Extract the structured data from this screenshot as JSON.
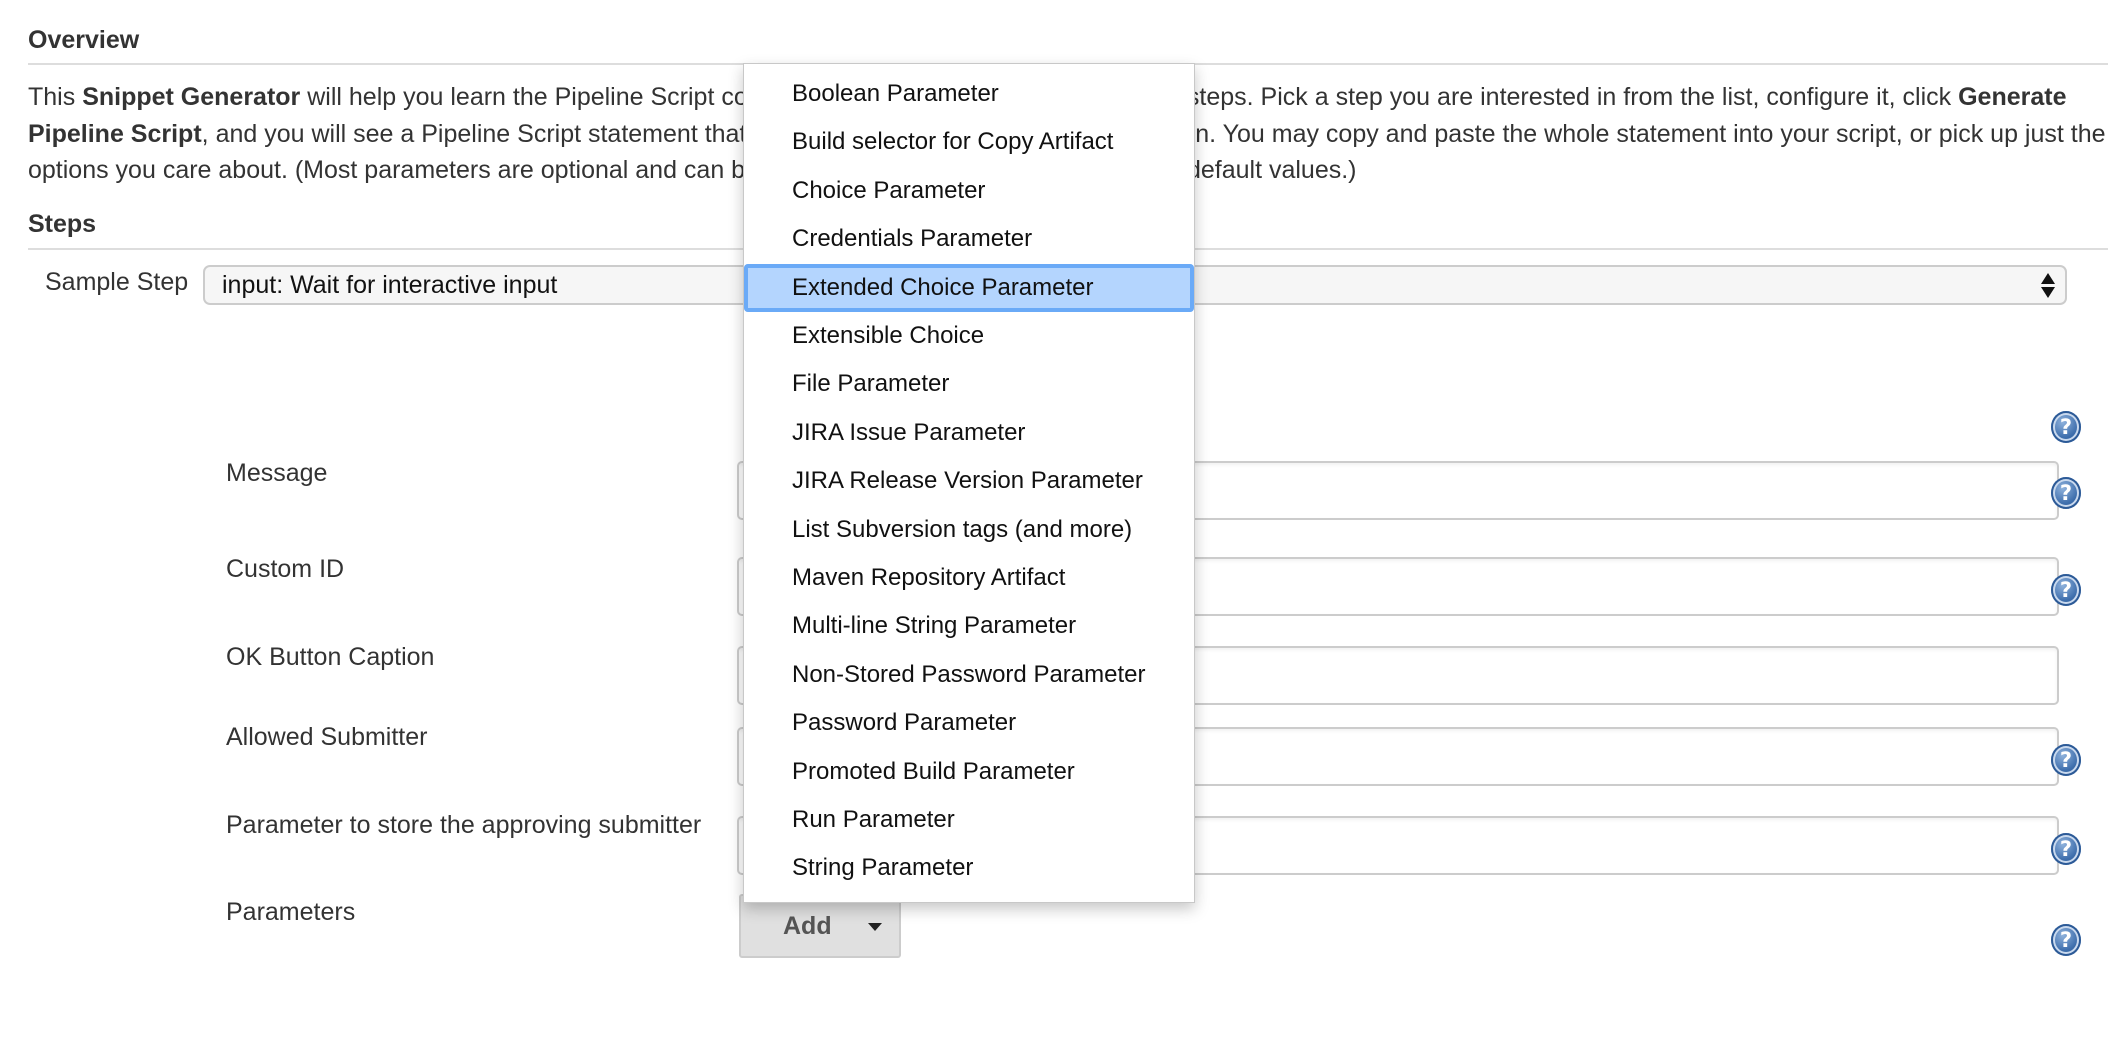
{
  "overview": {
    "title": "Overview",
    "text_parts": [
      {
        "text": "This ",
        "bold": false
      },
      {
        "text": "Snippet Generator",
        "bold": true
      },
      {
        "text": " will help you learn the Pipeline Script code which can be used to define various steps. Pick a step you are interested in from the list, configure it, click ",
        "bold": false
      },
      {
        "text": "Generate Pipeline Script",
        "bold": true
      },
      {
        "text": ", and you will see a Pipeline Script statement that would call the step with that configuration. You may copy and paste the whole statement into your script, or pick up just the options you care about. (Most parameters are optional and can be omitted in your script, leaving them at default values.)",
        "bold": false
      }
    ]
  },
  "steps": {
    "title": "Steps",
    "sample_step_label": "Sample Step",
    "sample_step_value": "input: Wait for interactive input"
  },
  "form": {
    "fields": [
      {
        "label": "Message",
        "value": "",
        "has_help": true
      },
      {
        "label": "Custom ID",
        "value": "",
        "has_help": true
      },
      {
        "label": "OK Button Caption",
        "value": "",
        "has_help": false
      },
      {
        "label": "Allowed Submitter",
        "value": "",
        "has_help": true
      },
      {
        "label": "Parameter to store the approving submitter",
        "value": "",
        "has_help": true
      }
    ],
    "parameters_label": "Parameters",
    "add_button_label": "Add",
    "help_glyph": "?"
  },
  "dropdown": {
    "selected_index": 4,
    "items": [
      "Boolean Parameter",
      "Build selector for Copy Artifact",
      "Choice Parameter",
      "Credentials Parameter",
      "Extended Choice Parameter",
      "Extensible Choice",
      "File Parameter",
      "JIRA Issue Parameter",
      "JIRA Release Version Parameter",
      "List Subversion tags (and more)",
      "Maven Repository Artifact",
      "Multi-line String Parameter",
      "Non-Stored Password Parameter",
      "Password Parameter",
      "Promoted Build Parameter",
      "Run Parameter",
      "String Parameter"
    ]
  },
  "colors": {
    "text": "#333333",
    "highlight_fill": "#b4d5fe",
    "highlight_ring": "#6aaaf7",
    "help_icon": "#3f6fad"
  }
}
